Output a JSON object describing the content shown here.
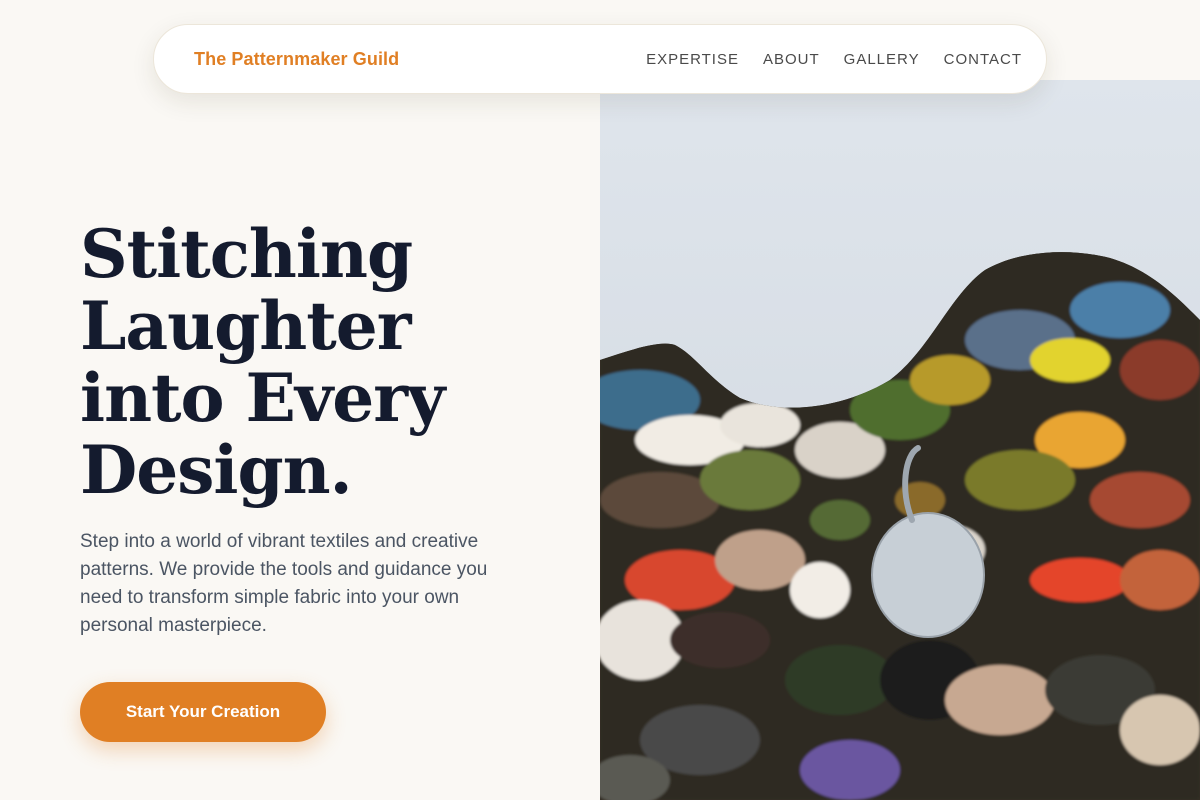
{
  "nav": {
    "brand": "The Patternmaker Guild",
    "links": [
      {
        "label": "EXPERTISE"
      },
      {
        "label": "ABOUT"
      },
      {
        "label": "GALLERY"
      },
      {
        "label": "CONTACT"
      }
    ]
  },
  "hero": {
    "title_lines": [
      "Stitching",
      "Laughter",
      "into Every",
      "Design."
    ],
    "subtitle": "Step into a world of vibrant textiles and creative patterns. We provide the tools and guidance you need to transform simple fabric into your own personal masterpiece.",
    "cta_label": "Start Your Creation"
  },
  "image": {
    "subject": "paint-palette-photo"
  },
  "colors": {
    "accent": "#e07f24",
    "heading": "#141b2e",
    "body_text": "#4b5563",
    "background": "#faf8f4"
  }
}
